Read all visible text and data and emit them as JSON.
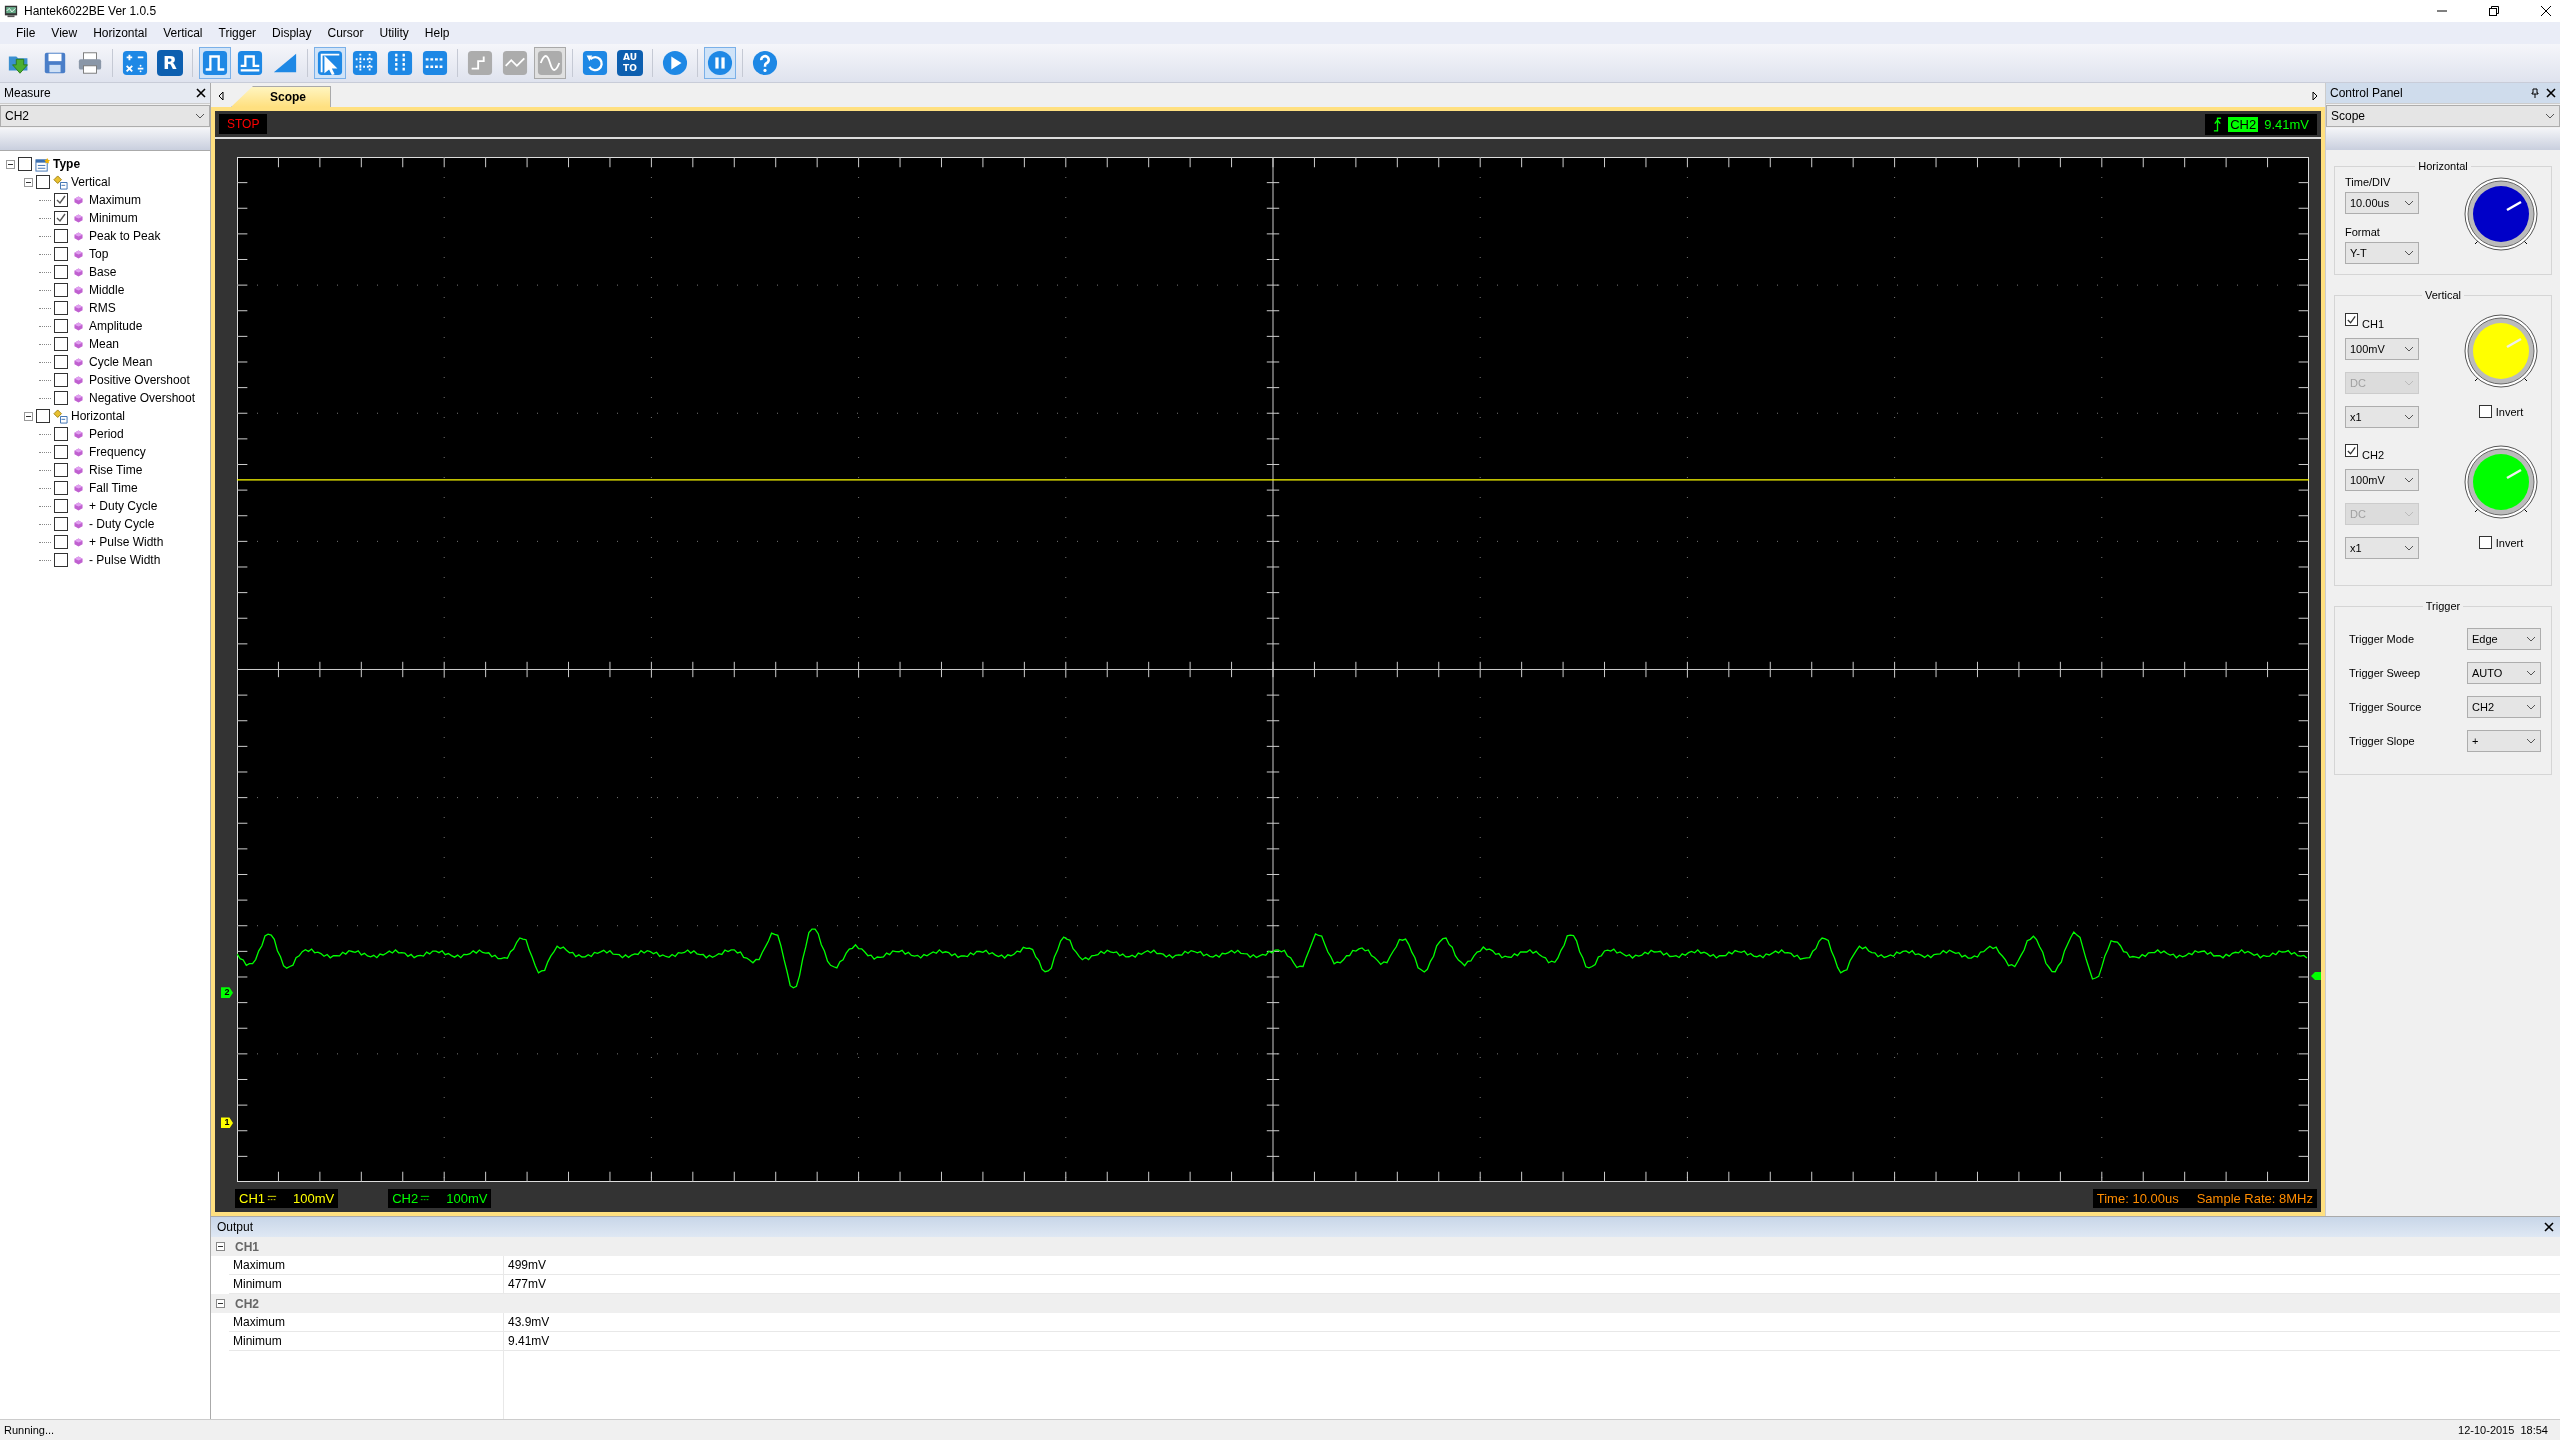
{
  "window": {
    "title": "Hantek6022BE Ver 1.0.5"
  },
  "menu": [
    "File",
    "View",
    "Horizontal",
    "Vertical",
    "Trigger",
    "Display",
    "Cursor",
    "Utility",
    "Help"
  ],
  "toolbar": [
    {
      "kind": "open",
      "selected": false,
      "disabled": false
    },
    {
      "kind": "save",
      "selected": false,
      "disabled": false
    },
    {
      "kind": "print",
      "selected": false,
      "disabled": false
    },
    {
      "kind": "math",
      "selected": false,
      "disabled": false
    },
    {
      "kind": "letter",
      "label": "R",
      "selected": false,
      "disabled": false
    },
    {
      "kind": "pulse",
      "selected": true,
      "disabled": false
    },
    {
      "kind": "pulse-edge",
      "selected": false,
      "disabled": false
    },
    {
      "kind": "ramp",
      "selected": false,
      "disabled": false
    },
    {
      "kind": "pointer",
      "selected": true,
      "disabled": false
    },
    {
      "kind": "crosshair",
      "selected": false,
      "disabled": false
    },
    {
      "kind": "vcursor",
      "selected": false,
      "disabled": false
    },
    {
      "kind": "hcursor",
      "selected": false,
      "disabled": false
    },
    {
      "kind": "step",
      "selected": false,
      "disabled": true
    },
    {
      "kind": "zigzag",
      "selected": false,
      "disabled": true
    },
    {
      "kind": "sine",
      "selected": true,
      "disabled": true
    },
    {
      "kind": "undo",
      "selected": false,
      "disabled": false
    },
    {
      "kind": "letter",
      "label": "AUTO",
      "selected": false,
      "disabled": false
    },
    {
      "kind": "run",
      "selected": false,
      "disabled": false
    },
    {
      "kind": "pause",
      "selected": true,
      "disabled": false
    },
    {
      "kind": "help",
      "selected": false,
      "disabled": false
    }
  ],
  "measure": {
    "title": "Measure",
    "channel": "CH2",
    "tree": {
      "label": "Type",
      "checked": false,
      "expanded": true,
      "children": [
        {
          "label": "Vertical",
          "checked": false,
          "expanded": true,
          "children": [
            {
              "label": "Maximum",
              "checked": true
            },
            {
              "label": "Minimum",
              "checked": true
            },
            {
              "label": "Peak to Peak",
              "checked": false
            },
            {
              "label": "Top",
              "checked": false
            },
            {
              "label": "Base",
              "checked": false
            },
            {
              "label": "Middle",
              "checked": false
            },
            {
              "label": "RMS",
              "checked": false
            },
            {
              "label": "Amplitude",
              "checked": false
            },
            {
              "label": "Mean",
              "checked": false
            },
            {
              "label": "Cycle Mean",
              "checked": false
            },
            {
              "label": "Positive Overshoot",
              "checked": false
            },
            {
              "label": "Negative Overshoot",
              "checked": false
            }
          ]
        },
        {
          "label": "Horizontal",
          "checked": false,
          "expanded": true,
          "children": [
            {
              "label": "Period",
              "checked": false
            },
            {
              "label": "Frequency",
              "checked": false
            },
            {
              "label": "Rise Time",
              "checked": false
            },
            {
              "label": "Fall Time",
              "checked": false
            },
            {
              "label": "+ Duty Cycle",
              "checked": false
            },
            {
              "label": "- Duty Cycle",
              "checked": false
            },
            {
              "label": "+ Pulse Width",
              "checked": false
            },
            {
              "label": "- Pulse Width",
              "checked": false
            }
          ]
        }
      ]
    }
  },
  "tabs": [
    {
      "label": "Scope",
      "selected": true
    }
  ],
  "scope": {
    "status": "STOP",
    "trigger_channel": "CH2",
    "trigger_value": "9.41mV",
    "markers": [
      {
        "label": "2",
        "color": "#00ff00"
      },
      {
        "label": "1",
        "color": "#ffff00"
      }
    ],
    "channels": [
      {
        "name": "CH1",
        "scale": "100mV",
        "color": "#ffff00"
      },
      {
        "name": "CH2",
        "scale": "100mV",
        "color": "#00ff00"
      }
    ],
    "time": "Time: 10.00us",
    "sample_rate": "Sample Rate: 8MHz"
  },
  "control_panel": {
    "title": "Control Panel",
    "mode": "Scope",
    "horizontal": {
      "title": "Horizontal",
      "time_div_label": "Time/DIV",
      "time_div": "10.00us",
      "format_label": "Format",
      "format": "Y-T"
    },
    "vertical": {
      "title": "Vertical",
      "channels": [
        {
          "name": "CH1",
          "checked": true,
          "volts": "100mV",
          "coupling": "DC",
          "coupling_disabled": true,
          "probe": "x1",
          "invert_label": "Invert",
          "invert": false,
          "color": "#ffff00"
        },
        {
          "name": "CH2",
          "checked": true,
          "volts": "100mV",
          "coupling": "DC",
          "coupling_disabled": true,
          "probe": "x1",
          "invert_label": "Invert",
          "invert": false,
          "color": "#00ff00"
        }
      ]
    },
    "trigger": {
      "title": "Trigger",
      "fields": [
        {
          "label": "Trigger Mode",
          "value": "Edge"
        },
        {
          "label": "Trigger Sweep",
          "value": "AUTO"
        },
        {
          "label": "Trigger Source",
          "value": "CH2"
        },
        {
          "label": "Trigger Slope",
          "value": "+"
        }
      ]
    }
  },
  "output": {
    "title": "Output",
    "groups": [
      {
        "name": "CH1",
        "expanded": true,
        "rows": [
          {
            "label": "Maximum",
            "value": "499mV"
          },
          {
            "label": "Minimum",
            "value": "477mV"
          }
        ]
      },
      {
        "name": "CH2",
        "expanded": true,
        "rows": [
          {
            "label": "Maximum",
            "value": "43.9mV"
          },
          {
            "label": "Minimum",
            "value": "9.41mV"
          }
        ]
      }
    ]
  },
  "status_bar": {
    "left": "Running...",
    "right": "12-10-2015  18:54"
  }
}
